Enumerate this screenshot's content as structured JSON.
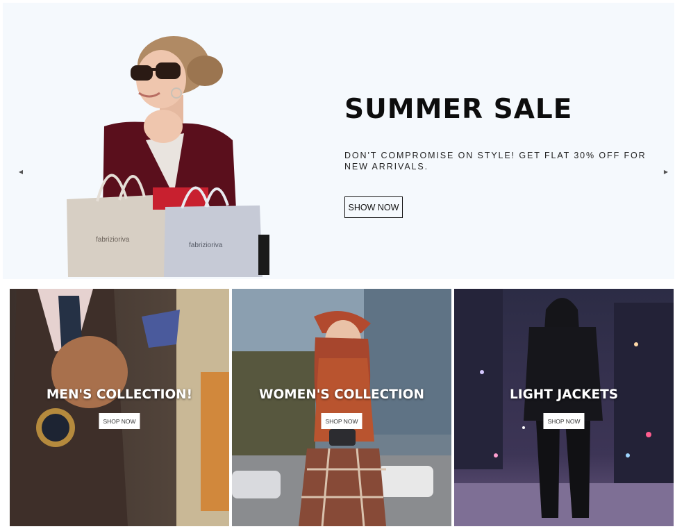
{
  "hero": {
    "title": "SUMMER SALE",
    "description": "DON'T COMPROMISE ON STYLE! GET FLAT 30% OFF FOR NEW ARRIVALS.",
    "button_label": "SHOW NOW",
    "bag_brand": "fabrizioriva",
    "background_color": "#f5f9fd"
  },
  "slider": {
    "prev_icon": "caret-left-icon",
    "next_icon": "caret-right-icon"
  },
  "categories": [
    {
      "title": "MEN'S COLLECTION!",
      "button_label": "SHOP NOW"
    },
    {
      "title": "WOMEN'S COLLECTION",
      "button_label": "SHOP NOW"
    },
    {
      "title": "LIGHT JACKETS",
      "button_label": "SHOP NOW"
    }
  ]
}
